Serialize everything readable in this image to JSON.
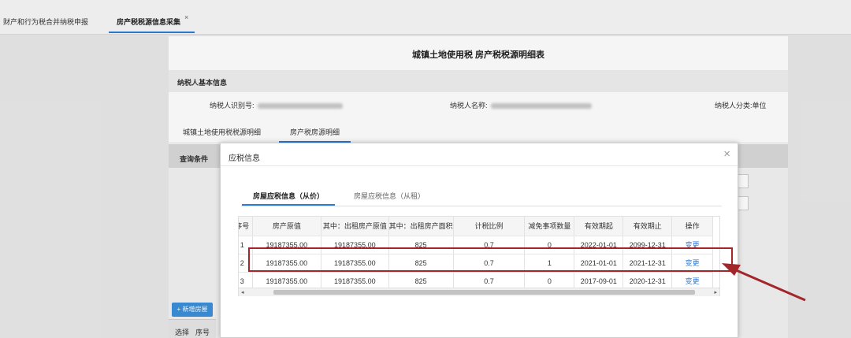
{
  "tabs": [
    {
      "label": "财产和行为税合并纳税申报"
    },
    {
      "label": "房产税税源信息采集"
    }
  ],
  "tab_close_glyph": "×",
  "form": {
    "title": "城镇土地使用税 房产税税源明细表",
    "section_title": "纳税人基本信息",
    "taxpayer_id_label": "纳税人识别号:",
    "taxpayer_name_label": "纳税人名称:",
    "taxpayer_type_label": "纳税人分类:",
    "taxpayer_type_value": "单位",
    "subtabs": [
      {
        "label": "城镇土地使用税税源明细"
      },
      {
        "label": "房产税房源明细"
      }
    ],
    "query_label": "查询条件",
    "add_button": "+ 新增房屋",
    "bottom_cols": [
      "选择",
      "序号"
    ]
  },
  "modal": {
    "title": "应税信息",
    "close_glyph": "×",
    "tabs": [
      {
        "label": "房屋应税信息（从价）"
      },
      {
        "label": "房屋应税信息（从租）"
      }
    ],
    "columns": [
      "序号",
      "房产原值",
      "其中：出租房产原值",
      "其中：出租房产面积",
      "计税比例",
      "减免事项数量",
      "有效期起",
      "有效期止",
      "操作"
    ],
    "rows": [
      {
        "seq": "1",
        "value": "19187355.00",
        "rent_value": "19187355.00",
        "rent_area": "825",
        "ratio": "0.7",
        "relief": "0",
        "start": "2022-01-01",
        "end": "2099-12-31",
        "action": "变更"
      },
      {
        "seq": "2",
        "value": "19187355.00",
        "rent_value": "19187355.00",
        "rent_area": "825",
        "ratio": "0.7",
        "relief": "1",
        "start": "2021-01-01",
        "end": "2021-12-31",
        "action": "变更"
      },
      {
        "seq": "3",
        "value": "19187355.00",
        "rent_value": "19187355.00",
        "rent_area": "825",
        "ratio": "0.7",
        "relief": "0",
        "start": "2017-09-01",
        "end": "2020-12-31",
        "action": "变更"
      }
    ],
    "scroll_left_glyph": "◂",
    "scroll_right_glyph": "▸"
  },
  "colors": {
    "accent": "#2e7bd6",
    "highlight": "#a3262b",
    "add_button": "#3b8fd9"
  }
}
